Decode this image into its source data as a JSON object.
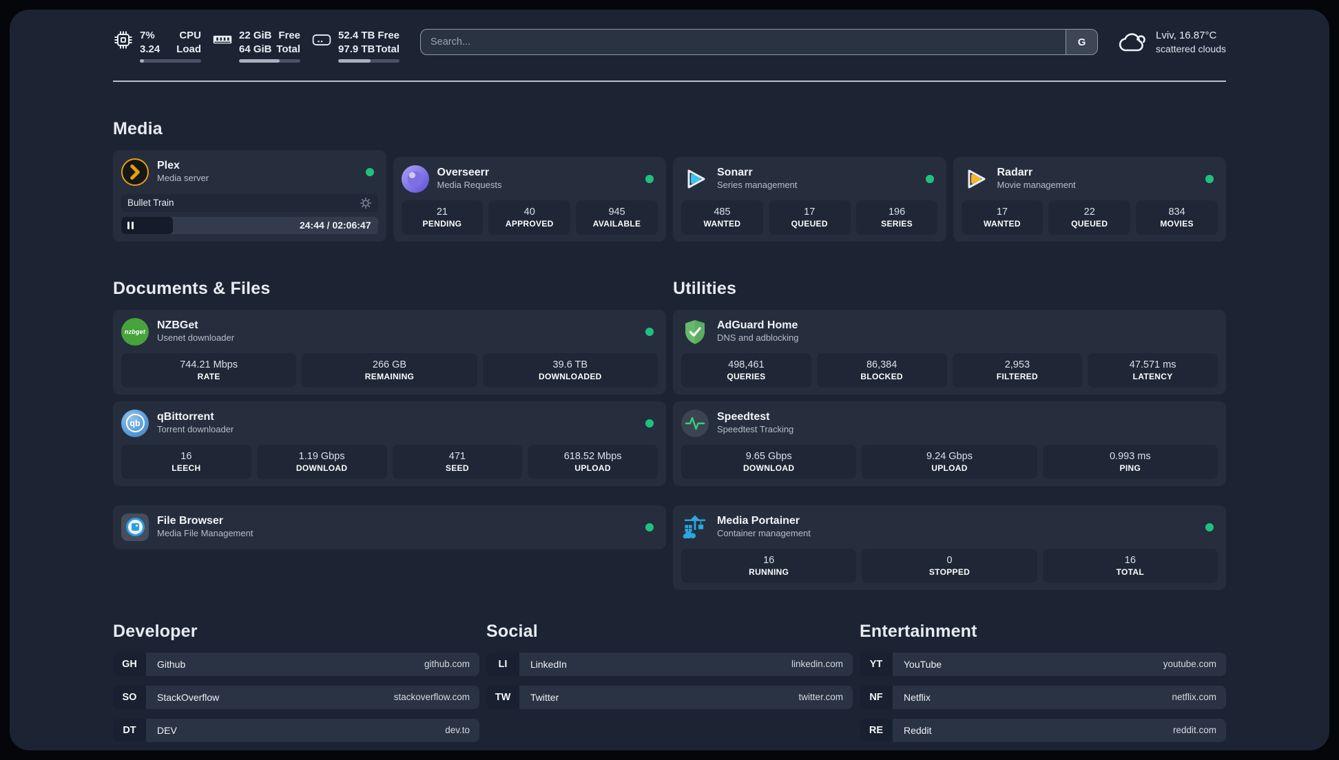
{
  "topbar": {
    "cpu": {
      "icon": "cpu-icon",
      "value_top": "7%",
      "value_bottom": "3.24",
      "label_top": "CPU",
      "label_bottom": "Load",
      "progress_pct": 7
    },
    "ram": {
      "icon": "ram-icon",
      "value_top": "22 GiB",
      "value_bottom": "64 GiB",
      "label_top": "Free",
      "label_bottom": "Total",
      "progress_pct": 66
    },
    "disk": {
      "icon": "disk-icon",
      "value_top": "52.4 TB",
      "value_bottom": "97.9 TB",
      "label_top": "Free",
      "label_bottom": "Total",
      "progress_pct": 53
    },
    "search": {
      "placeholder": "Search...",
      "engine_label": "G"
    },
    "weather": {
      "icon": "cloud-icon",
      "location_temp": "Lviv, 16.87°C",
      "condition": "scattered clouds"
    }
  },
  "sections": {
    "media": {
      "title": "Media",
      "plex": {
        "name": "Plex",
        "description": "Media server",
        "online": true,
        "now_playing": {
          "title": "Bullet Train",
          "time_display": "24:44 / 02:06:47",
          "progress_pct": 20
        }
      },
      "overseerr": {
        "name": "Overseerr",
        "description": "Media Requests",
        "online": true,
        "stats": [
          {
            "value": "21",
            "label": "PENDING"
          },
          {
            "value": "40",
            "label": "APPROVED"
          },
          {
            "value": "945",
            "label": "AVAILABLE"
          }
        ]
      },
      "sonarr": {
        "name": "Sonarr",
        "description": "Series management",
        "online": true,
        "stats": [
          {
            "value": "485",
            "label": "WANTED"
          },
          {
            "value": "17",
            "label": "QUEUED"
          },
          {
            "value": "196",
            "label": "SERIES"
          }
        ]
      },
      "radarr": {
        "name": "Radarr",
        "description": "Movie management",
        "online": true,
        "stats": [
          {
            "value": "17",
            "label": "WANTED"
          },
          {
            "value": "22",
            "label": "QUEUED"
          },
          {
            "value": "834",
            "label": "MOVIES"
          }
        ]
      }
    },
    "documents": {
      "title": "Documents & Files",
      "nzbget": {
        "name": "NZBGet",
        "description": "Usenet downloader",
        "online": true,
        "icon_text": "nzbget",
        "stats": [
          {
            "value": "744.21 Mbps",
            "label": "RATE"
          },
          {
            "value": "266 GB",
            "label": "REMAINING"
          },
          {
            "value": "39.6 TB",
            "label": "DOWNLOADED"
          }
        ]
      },
      "qbittorrent": {
        "name": "qBittorrent",
        "description": "Torrent downloader",
        "online": true,
        "icon_text": "qb",
        "stats": [
          {
            "value": "16",
            "label": "LEECH"
          },
          {
            "value": "1.19 Gbps",
            "label": "DOWNLOAD"
          },
          {
            "value": "471",
            "label": "SEED"
          },
          {
            "value": "618.52 Mbps",
            "label": "UPLOAD"
          }
        ]
      },
      "filebrowser": {
        "name": "File Browser",
        "description": "Media File Management",
        "online": true
      }
    },
    "utilities": {
      "title": "Utilities",
      "adguard": {
        "name": "AdGuard Home",
        "description": "DNS and adblocking",
        "stats": [
          {
            "value": "498,461",
            "label": "QUERIES"
          },
          {
            "value": "86,384",
            "label": "BLOCKED"
          },
          {
            "value": "2,953",
            "label": "FILTERED"
          },
          {
            "value": "47.571 ms",
            "label": "LATENCY"
          }
        ]
      },
      "speedtest": {
        "name": "Speedtest",
        "description": "Speedtest Tracking",
        "stats": [
          {
            "value": "9.65 Gbps",
            "label": "DOWNLOAD"
          },
          {
            "value": "9.24 Gbps",
            "label": "UPLOAD"
          },
          {
            "value": "0.993 ms",
            "label": "PING"
          }
        ]
      },
      "portainer": {
        "name": "Media Portainer",
        "description": "Container management",
        "online": true,
        "stats": [
          {
            "value": "16",
            "label": "RUNNING"
          },
          {
            "value": "0",
            "label": "STOPPED"
          },
          {
            "value": "16",
            "label": "TOTAL"
          }
        ]
      }
    },
    "developer": {
      "title": "Developer",
      "links": [
        {
          "abbr": "GH",
          "name": "Github",
          "url": "github.com"
        },
        {
          "abbr": "SO",
          "name": "StackOverflow",
          "url": "stackoverflow.com"
        },
        {
          "abbr": "DT",
          "name": "DEV",
          "url": "dev.to"
        }
      ]
    },
    "social": {
      "title": "Social",
      "links": [
        {
          "abbr": "LI",
          "name": "LinkedIn",
          "url": "linkedin.com"
        },
        {
          "abbr": "TW",
          "name": "Twitter",
          "url": "twitter.com"
        }
      ]
    },
    "entertainment": {
      "title": "Entertainment",
      "links": [
        {
          "abbr": "YT",
          "name": "YouTube",
          "url": "youtube.com"
        },
        {
          "abbr": "NF",
          "name": "Netflix",
          "url": "netflix.com"
        },
        {
          "abbr": "RE",
          "name": "Reddit",
          "url": "reddit.com"
        }
      ]
    }
  },
  "colors": {
    "background": "#1c2434",
    "card": "#262e3e",
    "stat_box": "#1f2736",
    "status_online": "#1ec27d",
    "plex_accent": "#e5a00d",
    "overseerr_purple": "#6a5ce0",
    "sonarr_cyan": "#38c5f1",
    "radarr_yellow": "#f7b52c",
    "nzbget_green": "#47a33c",
    "qbittorrent_blue": "#4a90cf",
    "adguard_green": "#66b96b",
    "speedtest_green": "#35d07f",
    "portainer_blue": "#2aa7e0",
    "filebrowser_blue": "#2d9ce0",
    "divider": "#ccd2da"
  }
}
